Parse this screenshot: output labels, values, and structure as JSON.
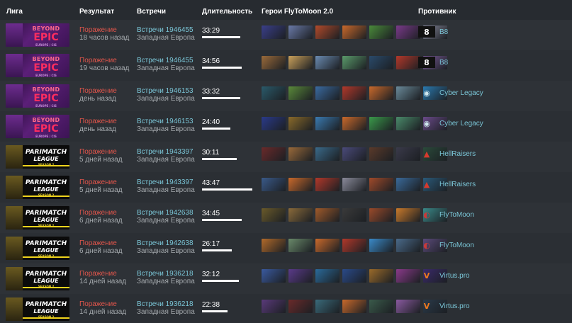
{
  "header": {
    "league": "Лига",
    "result": "Результат",
    "matches": "Встречи",
    "duration": "Длительность",
    "heroes": "Герои FlyToMoon 2.0",
    "opponent": "Противник"
  },
  "rows": [
    {
      "league": "beyond-epic",
      "league_lines": [
        "BEYOND",
        "EPIC",
        "EUROPE / CIS"
      ],
      "result": "Поражение",
      "when": "18 часов назад",
      "match": "Встречи 1946455",
      "region": "Западная Европа",
      "duration": "33:29",
      "duration_frac": 0.72,
      "opponent": "B8",
      "opp_icon": "b8-logo-icon",
      "opp_color": "#ffffff",
      "opp_bg": "#111111",
      "heroes": [
        "#3a3f8a",
        "#6a7aa8",
        "#b24a2a",
        "#c9692b",
        "#4a8a3a",
        "#7a3a8a",
        "#8a8aa0"
      ]
    },
    {
      "league": "beyond-epic",
      "league_lines": [
        "BEYOND",
        "EPIC",
        "EUROPE / CIS"
      ],
      "result": "Поражение",
      "when": "19 часов назад",
      "match": "Встречи 1946455",
      "region": "Западная Европа",
      "duration": "34:56",
      "duration_frac": 0.75,
      "opponent": "B8",
      "opp_icon": "b8-logo-icon",
      "opp_color": "#ffffff",
      "opp_bg": "#111111",
      "heroes": [
        "#9a6a3a",
        "#c9a05a",
        "#6a8ab0",
        "#5a9a6a",
        "#2a4a6a",
        "#b2382a",
        "#7a5a9a"
      ]
    },
    {
      "league": "beyond-epic",
      "league_lines": [
        "BEYOND",
        "EPIC",
        "EUROPE / CIS"
      ],
      "result": "Поражение",
      "when": "день назад",
      "match": "Встречи 1946153",
      "region": "Западная Европа",
      "duration": "33:32",
      "duration_frac": 0.72,
      "opponent": "Cyber Legacy",
      "opp_icon": "cyber-legacy-logo-icon",
      "opp_color": "#cfe7ee",
      "opp_bg": "transparent",
      "heroes": [
        "#2a5a6a",
        "#5a8a3a",
        "#3a6aa0",
        "#b2382a",
        "#c9692b",
        "#6a8a9a",
        "#2a7ab0"
      ]
    },
    {
      "league": "beyond-epic",
      "league_lines": [
        "BEYOND",
        "EPIC",
        "EUROPE / CIS"
      ],
      "result": "Поражение",
      "when": "день назад",
      "match": "Встречи 1946153",
      "region": "Западная Европа",
      "duration": "24:40",
      "duration_frac": 0.53,
      "opponent": "Cyber Legacy",
      "opp_icon": "cyber-legacy-logo-icon",
      "opp_color": "#cfe7ee",
      "opp_bg": "transparent",
      "heroes": [
        "#2a3a8a",
        "#8a6a2a",
        "#3a7ab0",
        "#c9692b",
        "#3a9a4a",
        "#4a8a6a",
        "#6a4a8a"
      ]
    },
    {
      "league": "parimatch",
      "league_lines": [
        "PARIMATCH",
        "LEAGUE",
        "SEASON 2"
      ],
      "result": "Поражение",
      "when": "5 дней назад",
      "match": "Встречи 1943397",
      "region": "Западная Европа",
      "duration": "30:11",
      "duration_frac": 0.65,
      "opponent": "HellRaisers",
      "opp_icon": "hellraisers-logo-icon",
      "opp_color": "#d43a2e",
      "opp_bg": "transparent",
      "heroes": [
        "#6a2a2a",
        "#9a6a3a",
        "#3a6a8a",
        "#4a4a7a",
        "#5a3a2a",
        "#3a3a4a",
        "#2a4a3a"
      ]
    },
    {
      "league": "parimatch",
      "league_lines": [
        "PARIMATCH",
        "LEAGUE",
        "SEASON 2"
      ],
      "result": "Поражение",
      "when": "5 дней назад",
      "match": "Встречи 1943397",
      "region": "Западная Европа",
      "duration": "43:47",
      "duration_frac": 0.94,
      "opponent": "HellRaisers",
      "opp_icon": "hellraisers-logo-icon",
      "opp_color": "#d43a2e",
      "opp_bg": "transparent",
      "heroes": [
        "#3a5a8a",
        "#c9692b",
        "#b2382a",
        "#8a8a9a",
        "#a04a2a",
        "#3a6a9a",
        "#2a5a7a"
      ]
    },
    {
      "league": "parimatch",
      "league_lines": [
        "PARIMATCH",
        "LEAGUE",
        "SEASON 2"
      ],
      "result": "Поражение",
      "when": "6 дней назад",
      "match": "Встречи 1942638",
      "region": "Западная Европа",
      "duration": "34:45",
      "duration_frac": 0.75,
      "opponent": "FlyToMoon",
      "opp_icon": "flytomoon-logo-icon",
      "opp_color": "#c83a3a",
      "opp_bg": "transparent",
      "heroes": [
        "#6a5a2a",
        "#8a6a3a",
        "#a05a2a",
        "#3a3a3a",
        "#9a4a2a",
        "#c97a2b",
        "#3a8a8a"
      ]
    },
    {
      "league": "parimatch",
      "league_lines": [
        "PARIMATCH",
        "LEAGUE",
        "SEASON 2"
      ],
      "result": "Поражение",
      "when": "6 дней назад",
      "match": "Встречи 1942638",
      "region": "Западная Европа",
      "duration": "26:17",
      "duration_frac": 0.56,
      "opponent": "FlyToMoon",
      "opp_icon": "flytomoon-logo-icon",
      "opp_color": "#c83a3a",
      "opp_bg": "transparent",
      "heroes": [
        "#b26a2a",
        "#6a8a6a",
        "#c9692b",
        "#b2382a",
        "#3a8ac9",
        "#4a6a8a",
        "#5a4a7a"
      ]
    },
    {
      "league": "parimatch",
      "league_lines": [
        "PARIMATCH",
        "LEAGUE",
        "SEASON 2"
      ],
      "result": "Поражение",
      "when": "14 дней назад",
      "match": "Встречи 1936218",
      "region": "Западная Европа",
      "duration": "32:12",
      "duration_frac": 0.69,
      "opponent": "Virtus.pro",
      "opp_icon": "virtus-pro-logo-icon",
      "opp_color": "#f07a1e",
      "opp_bg": "transparent",
      "heroes": [
        "#3a5aa0",
        "#5a3a8a",
        "#2a6a9a",
        "#2a4a8a",
        "#9a6a2a",
        "#8a3a8a",
        "#3a2a6a"
      ]
    },
    {
      "league": "parimatch",
      "league_lines": [
        "PARIMATCH",
        "LEAGUE",
        "SEASON 2"
      ],
      "result": "Поражение",
      "when": "14 дней назад",
      "match": "Встречи 1936218",
      "region": "Западная Европа",
      "duration": "22:38",
      "duration_frac": 0.48,
      "opponent": "Virtus.pro",
      "opp_icon": "virtus-pro-logo-icon",
      "opp_color": "#f07a1e",
      "opp_bg": "transparent",
      "heroes": [
        "#5a3a7a",
        "#6a2a2a",
        "#3a6a7a",
        "#c9692b",
        "#3a5a4a",
        "#8a5aa0",
        "#2a3a4a"
      ]
    }
  ]
}
